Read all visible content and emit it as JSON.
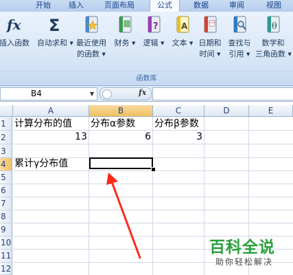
{
  "ribbon_tabs": [
    "开始",
    "插入",
    "页面布局",
    "公式",
    "数据",
    "审阅",
    "视图"
  ],
  "active_tab": "公式",
  "ribbon_buttons": [
    {
      "icon": "fx-icon",
      "line1": "插入函数",
      "line2": ""
    },
    {
      "icon": "sigma-icon",
      "line1": "自动求和",
      "line2": ""
    },
    {
      "icon": "star-book-icon",
      "line1": "最近使用",
      "line2": "的函数"
    },
    {
      "icon": "finance-book-icon",
      "line1": "财务",
      "line2": ""
    },
    {
      "icon": "question-book-icon",
      "line1": "逻辑",
      "line2": ""
    },
    {
      "icon": "text-book-icon",
      "line1": "文本",
      "line2": ""
    },
    {
      "icon": "calendar-book-icon",
      "line1": "日期和",
      "line2": "时间"
    },
    {
      "icon": "lookup-book-icon",
      "line1": "查找与",
      "line2": "引用"
    },
    {
      "icon": "theta-book-icon",
      "line1": "数学和",
      "line2": "三角函数"
    }
  ],
  "group_label": "函数库",
  "formula_bar": {
    "name_box": "B4",
    "fx_label": "fx",
    "formula": ""
  },
  "columns": [
    "A",
    "B",
    "C",
    "D",
    "E"
  ],
  "selected_column": "B",
  "rows": [
    "1",
    "2",
    "3",
    "4",
    "5",
    "6",
    "7",
    "8",
    "9",
    "10",
    "11",
    "12"
  ],
  "selected_row": "4",
  "cells": {
    "A1": "计算分布的值",
    "B1": "分布α参数",
    "C1": "分布β参数",
    "A2": "13",
    "B2": "6",
    "C2": "3",
    "A4": "累计γ分布值"
  },
  "watermark": {
    "title": "百科全说",
    "subtitle": "助你轻松解决"
  },
  "colors": {
    "ribbon": "#dbe8f8",
    "selected_header": "#f1c15f",
    "arrow": "#ff2a1a",
    "watermark": "#2aa03c"
  }
}
